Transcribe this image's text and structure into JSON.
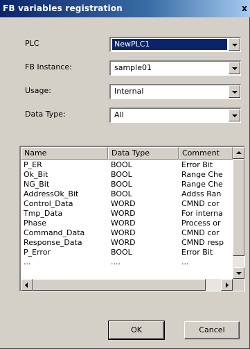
{
  "window": {
    "title": "FB variables registration",
    "close_label": "x"
  },
  "form": {
    "plc": {
      "label": "PLC",
      "value": "NewPLC1"
    },
    "fb_instance": {
      "label": "FB Instance:",
      "value": "sample01"
    },
    "usage": {
      "label": "Usage:",
      "value": "Internal"
    },
    "data_type": {
      "label": "Data Type:",
      "value": "All"
    }
  },
  "table": {
    "columns": [
      "Name",
      "Data Type",
      "Comment"
    ],
    "rows": [
      [
        "P_ER",
        "BOOL",
        "Error Bit"
      ],
      [
        "Ok_Bit",
        "BOOL",
        "Range Che"
      ],
      [
        "NG_Bit",
        "BOOL",
        "Range Che"
      ],
      [
        "AddressOk_Bit",
        "BOOL",
        "Addss Ran"
      ],
      [
        "Control_Data",
        "WORD",
        "CMND cor"
      ],
      [
        "Tmp_Data",
        "WORD",
        "For interna"
      ],
      [
        "Phase",
        "WORD",
        "Process or"
      ],
      [
        "Command_Data",
        "WORD",
        "CMND cor"
      ],
      [
        "Response_Data",
        "WORD",
        "CMND resp"
      ],
      [
        "P_Error",
        "BOOL",
        "Error Bit"
      ],
      [
        "...",
        "....",
        "..."
      ]
    ]
  },
  "buttons": {
    "ok": "OK",
    "cancel": "Cancel"
  },
  "icons": {
    "dropdown": "chevron-down-icon",
    "scroll_up": "scroll-up-icon",
    "scroll_down": "scroll-down-icon",
    "scroll_left": "scroll-left-icon",
    "scroll_right": "scroll-right-icon"
  },
  "colors": {
    "title_bar": "#0a246a",
    "selection": "#0a246a",
    "face": "#d4d0c8"
  }
}
